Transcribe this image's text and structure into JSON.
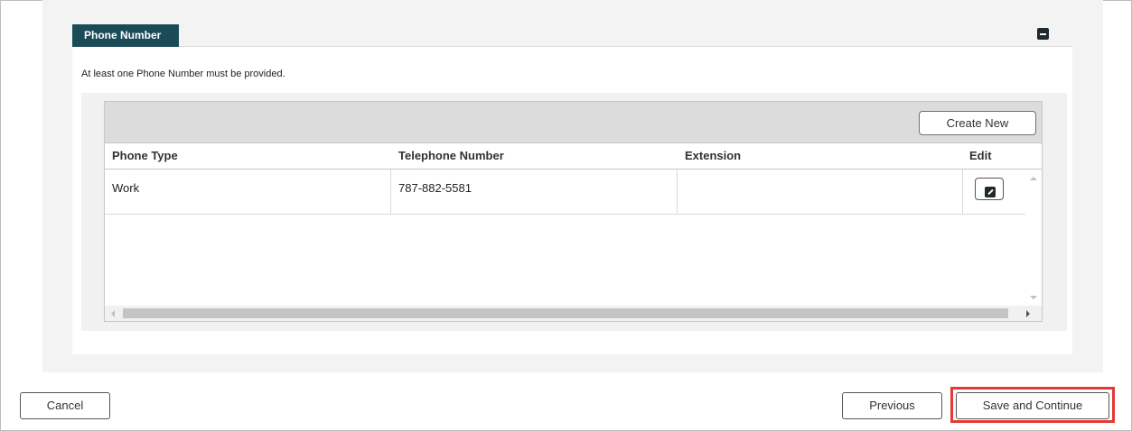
{
  "section": {
    "tab_label": "Phone Number",
    "notice": "At least one Phone Number must be provided."
  },
  "grid": {
    "create_label": "Create New",
    "columns": [
      "Phone Type",
      "Telephone Number",
      "Extension",
      "Edit"
    ],
    "rows": [
      {
        "phone_type": "Work",
        "telephone": "787-882-5581",
        "extension": ""
      }
    ]
  },
  "footer": {
    "cancel_label": "Cancel",
    "previous_label": "Previous",
    "save_label": "Save and Continue"
  },
  "colors": {
    "tab_bg": "#1b4b57",
    "highlight": "#e53935"
  }
}
